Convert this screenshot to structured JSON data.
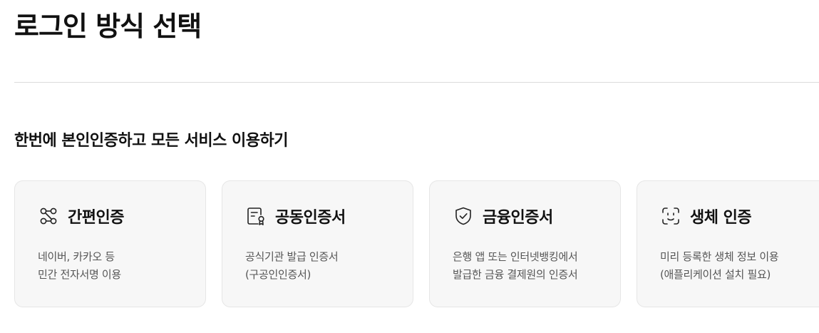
{
  "page": {
    "title": "로그인 방식 선택",
    "subtitle": "한번에 본인인증하고 모든 서비스 이용하기"
  },
  "methods": [
    {
      "icon": "simple-auth-nodes-icon",
      "title": "간편인증",
      "desc1": "네이버, 카카오 등",
      "desc2": "민간 전자서명 이용"
    },
    {
      "icon": "certificate-document-icon",
      "title": "공동인증서",
      "desc1": "공식기관 발급 인증서",
      "desc2": "(구공인인증서)"
    },
    {
      "icon": "shield-check-icon",
      "title": "금융인증서",
      "desc1": "은행 앱 또는 인터넷뱅킹에서",
      "desc2": "발급한 금융 결제원의 인증서"
    },
    {
      "icon": "face-id-icon",
      "title": "생체 인증",
      "desc1": "미리 등록한 생체 정보 이용",
      "desc2": "(애플리케이션 설치 필요)"
    }
  ]
}
